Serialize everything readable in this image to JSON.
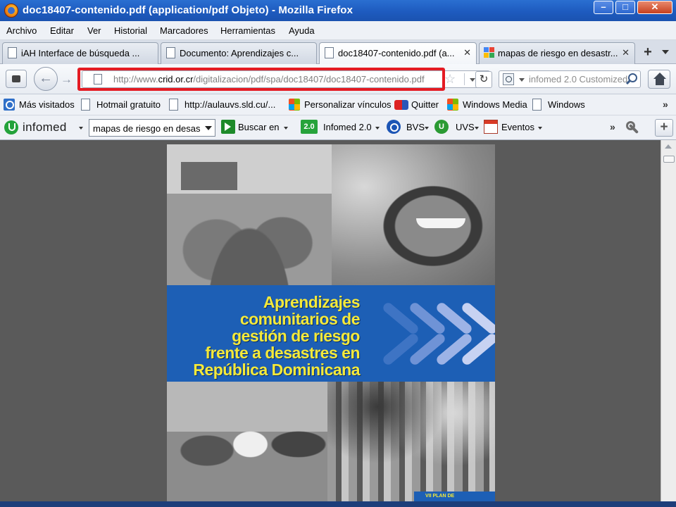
{
  "window": {
    "title": "doc18407-contenido.pdf (application/pdf Objeto) - Mozilla Firefox",
    "minimize": "–",
    "maximize": "□",
    "close": "✕"
  },
  "menubar": {
    "items": [
      "Archivo",
      "Editar",
      "Ver",
      "Historial",
      "Marcadores",
      "Herramientas",
      "Ayuda"
    ]
  },
  "tabs": [
    {
      "label": "iAH Interface de búsqueda ...",
      "icon": "page-icon",
      "active": false
    },
    {
      "label": "Documento: Aprendizajes c...",
      "icon": "page-icon",
      "active": false
    },
    {
      "label": "doc18407-contenido.pdf (a...",
      "icon": "page-icon",
      "active": true,
      "close": "✕"
    },
    {
      "label": "mapas de riesgo en desastr...",
      "icon": "google-icon",
      "active": false,
      "close": "✕"
    }
  ],
  "newtab_label": "+",
  "navbar": {
    "back": "←",
    "forward": "→",
    "url_prefix": "http://www.",
    "url_domain": "crid.or.cr",
    "url_path": "/digitalizacion/pdf/spa/doc18407/doc18407-contenido.pdf",
    "reload": "C",
    "search_placeholder": "infomed 2.0 Customized",
    "highlight_color": "#e41b23"
  },
  "bookmarks": [
    {
      "label": "Más visitados",
      "icon": "most-visited-icon"
    },
    {
      "label": "Hotmail gratuito",
      "icon": "page-icon"
    },
    {
      "label": "http://aulauvs.sld.cu/...",
      "icon": "page-icon"
    },
    {
      "label": "Personalizar vínculos",
      "icon": "windows-icon"
    },
    {
      "label": "Quitter",
      "icon": "quitter-icon"
    },
    {
      "label": "Windows Media",
      "icon": "windows-icon"
    },
    {
      "label": "Windows",
      "icon": "page-icon"
    }
  ],
  "bookmarks_more": "»",
  "infomed_toolbar": {
    "brand": "infomed",
    "search_value": "mapas de riesgo en desas",
    "buscar_label": "Buscar en",
    "infomed20_badge": "2.0",
    "infomed20_label": "Infomed 2.0",
    "bvs_label": "BVS",
    "uvs_badge": "U",
    "uvs_label": "UVS",
    "eventos_label": "Eventos",
    "more": "»",
    "add": "+"
  },
  "pdf": {
    "heading_lines": [
      "Aprendizajes",
      "comunitarios de",
      "gestión de riesgo",
      "frente a desastres en",
      "República Dominicana"
    ],
    "badge": "VII PLAN DE",
    "banner_color": "#1d5fb5",
    "heading_color": "#f4e93a"
  }
}
